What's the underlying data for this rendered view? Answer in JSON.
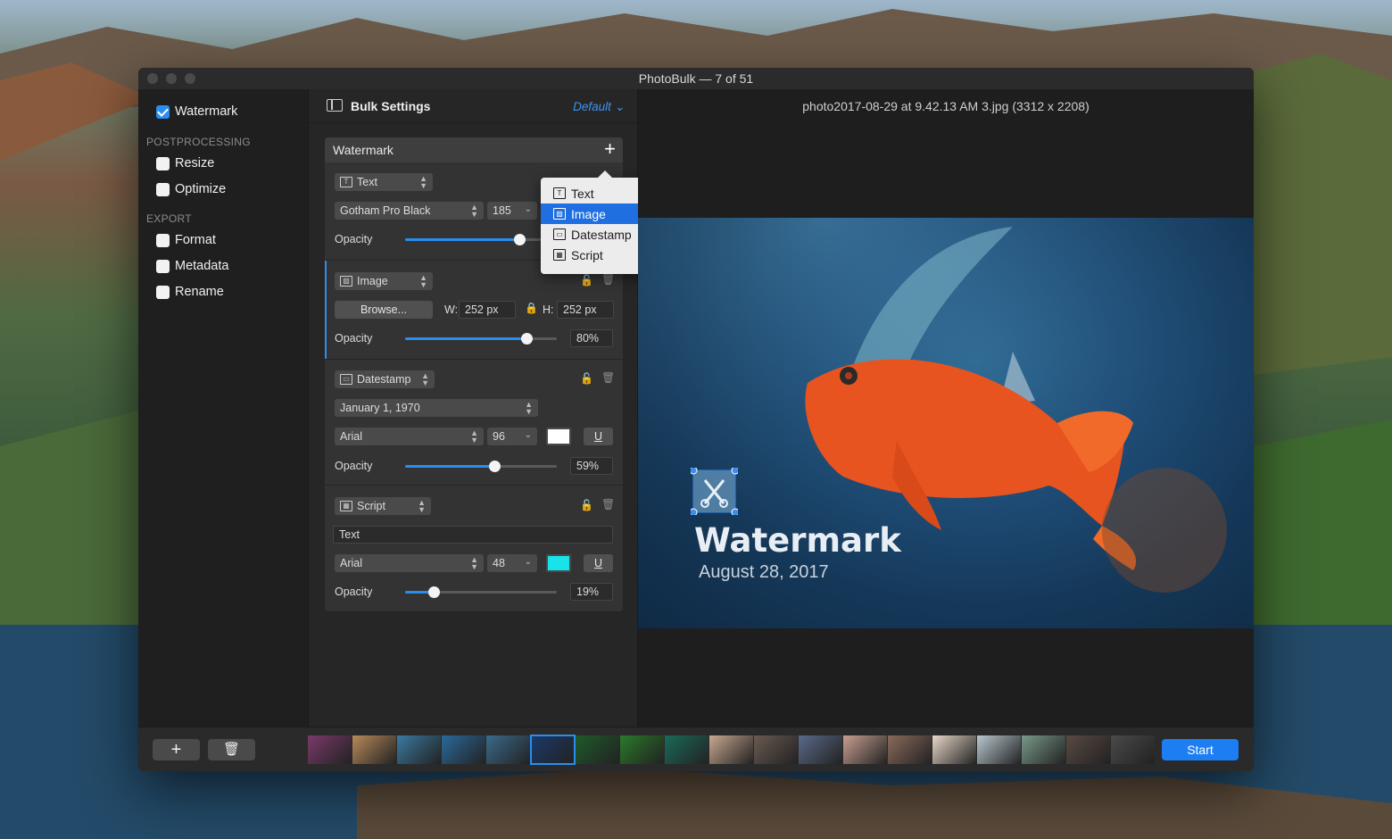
{
  "window": {
    "title": "PhotoBulk — 7 of 51"
  },
  "sidebar": {
    "watermark": {
      "label": "Watermark",
      "checked": true
    },
    "sections": [
      {
        "title": "POSTPROCESSING",
        "items": [
          {
            "label": "Resize",
            "checked": false
          },
          {
            "label": "Optimize",
            "checked": false
          }
        ]
      },
      {
        "title": "EXPORT",
        "items": [
          {
            "label": "Format",
            "checked": false
          },
          {
            "label": "Metadata",
            "checked": false
          },
          {
            "label": "Rename",
            "checked": false
          }
        ]
      }
    ]
  },
  "settings": {
    "title": "Bulk Settings",
    "preset": "Default",
    "panel_title": "Watermark",
    "text_block": {
      "type": "Text",
      "font": "Gotham Pro Black",
      "size": "185",
      "opacity_label": "Opacity",
      "opacity": 0.75
    },
    "image_block": {
      "type": "Image",
      "browse": "Browse...",
      "w_label": "W:",
      "w_value": "252 px",
      "h_label": "H:",
      "h_value": "252 px",
      "opacity_label": "Opacity",
      "opacity_value": "80%",
      "opacity": 0.8
    },
    "datestamp_block": {
      "type": "Datestamp",
      "date_format": "January 1, 1970",
      "font": "Arial",
      "size": "96",
      "color": "#ffffff",
      "underline": "U",
      "opacity_label": "Opacity",
      "opacity_value": "59%",
      "opacity": 0.59
    },
    "script_block": {
      "type": "Script",
      "text": "Text",
      "font": "Arial",
      "size": "48",
      "color": "#19e3ea",
      "underline": "U",
      "opacity_label": "Opacity",
      "opacity_value": "19%",
      "opacity": 0.19
    }
  },
  "dropdown": {
    "items": [
      {
        "label": "Text",
        "icon": "text-icon",
        "active": false
      },
      {
        "label": "Image",
        "icon": "image-icon",
        "active": true
      },
      {
        "label": "Datestamp",
        "icon": "calendar-icon",
        "active": false
      },
      {
        "label": "Script",
        "icon": "script-icon",
        "active": false
      }
    ]
  },
  "preview": {
    "filename": "photo2017-08-29 at 9.42.13 AM 3.jpg (3312 x 2208)",
    "watermark_text": "Watermark",
    "watermark_date": "August 28, 2017"
  },
  "bottom": {
    "add_label": "+",
    "start_label": "Start",
    "thumbnail_colors": [
      "#7a3a6a",
      "#b88a5a",
      "#3a7aa0",
      "#2a6a9a",
      "#3a6a8a",
      "#1a3a6a",
      "#1f5a2a",
      "#2a7a2a",
      "#1a6a5a",
      "#c8a890",
      "#6a5a52",
      "#5a6a8a",
      "#c8a090",
      "#8a6a5a",
      "#e8d8c8",
      "#b8c8d0",
      "#7a9a8a",
      "#5a4a42",
      "#4a4a4a"
    ],
    "selected_thumb": 5
  }
}
